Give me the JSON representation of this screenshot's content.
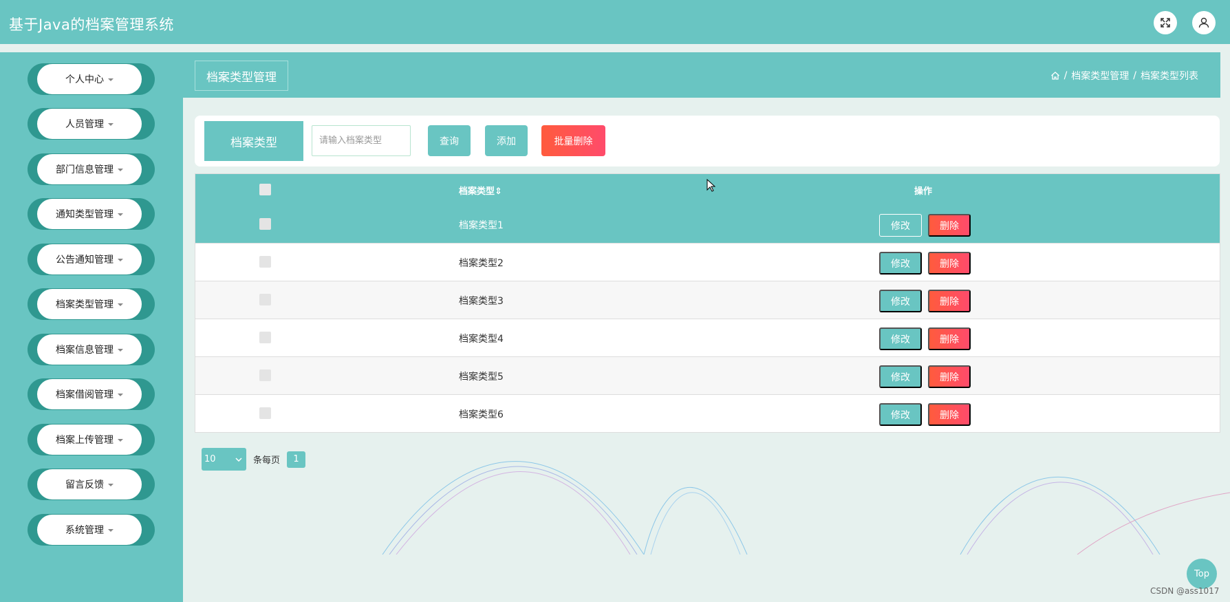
{
  "app": {
    "title": "基于Java的档案管理系统"
  },
  "header_icons": [
    "fullscreen-icon",
    "user-icon"
  ],
  "sidebar": {
    "items": [
      {
        "label": "个人中心"
      },
      {
        "label": "人员管理"
      },
      {
        "label": "部门信息管理"
      },
      {
        "label": "通知类型管理"
      },
      {
        "label": "公告通知管理"
      },
      {
        "label": "档案类型管理"
      },
      {
        "label": "档案信息管理"
      },
      {
        "label": "档案借阅管理"
      },
      {
        "label": "档案上传管理"
      },
      {
        "label": "留言反馈"
      },
      {
        "label": "系统管理"
      }
    ]
  },
  "page": {
    "title": "档案类型管理",
    "breadcrumb": [
      "档案类型管理",
      "档案类型列表"
    ]
  },
  "search": {
    "label": "档案类型",
    "placeholder": "请输入档案类型",
    "value": "",
    "query_button": "查询",
    "add_button": "添加",
    "batch_delete_button": "批量删除"
  },
  "table": {
    "columns": [
      "档案类型",
      "操作"
    ],
    "sort_icon": "⇕",
    "rows": [
      {
        "type": "档案类型1"
      },
      {
        "type": "档案类型2"
      },
      {
        "type": "档案类型3"
      },
      {
        "type": "档案类型4"
      },
      {
        "type": "档案类型5"
      },
      {
        "type": "档案类型6"
      }
    ],
    "edit_label": "修改",
    "delete_label": "删除"
  },
  "pagination": {
    "page_size": "10",
    "per_page_label": "条每页",
    "current_page": "1"
  },
  "back_to_top": "Top",
  "watermark": "CSDN @ass1017",
  "colors": {
    "primary": "#69c5c2",
    "danger": "#ff5046",
    "sidebar_pill_edge": "#2f9890"
  }
}
